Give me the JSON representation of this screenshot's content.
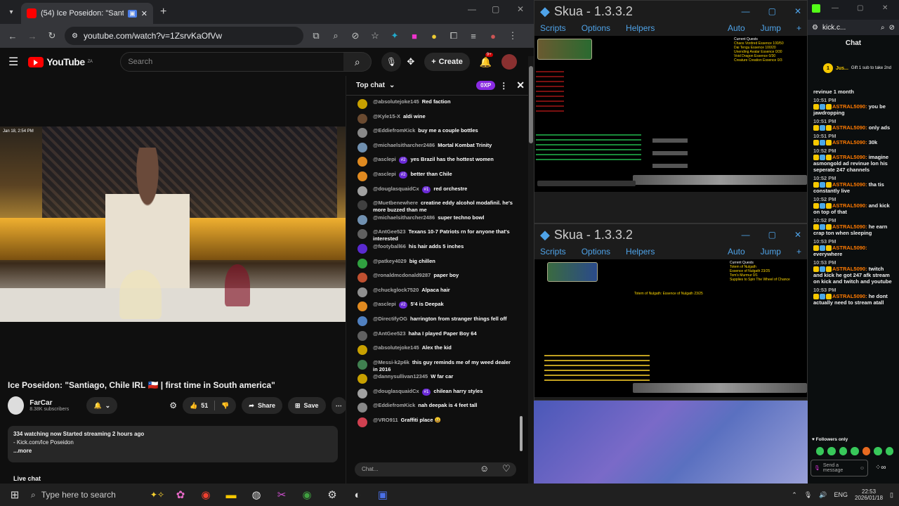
{
  "browser": {
    "tab_title": "(54) Ice Poseidon: \"Santiago, C",
    "url": "youtube.com/watch?v=1ZsrvKaOfVw"
  },
  "youtube": {
    "region": "ZA",
    "search_placeholder": "Search",
    "create_label": "Create",
    "notif_count": "9+",
    "video_overlay_time": "Jan 18, 2:54 PM",
    "title": "Ice Poseidon: \"Santiago, Chile IRL 🇨🇱 | first time in South america\"",
    "channel_name": "FarCar",
    "subscribers": "8.38K subscribers",
    "likes": "51",
    "share_label": "Share",
    "save_label": "Save",
    "desc_line1": "334 watching now  Started streaming 2 hours ago",
    "desc_line2": "- Kick.com/Ice Poseidon",
    "desc_more": "...more",
    "live_chat_label": "Live chat"
  },
  "chat": {
    "header": "Top chat",
    "xp_label": "0XP",
    "input_placeholder": "Chat...",
    "messages": [
      {
        "author": "@absolutejoke145",
        "text": "Red faction",
        "color": "#c8a000"
      },
      {
        "author": "@Kyle15-X",
        "text": "aldi wine",
        "color": "#6a4a30"
      },
      {
        "author": "@EddiefromKick",
        "text": "buy me a couple bottles",
        "color": "#888888"
      },
      {
        "author": "@michaelsitharcher2486",
        "text": "Mortal Kombat Trinity",
        "color": "#7090b0"
      },
      {
        "author": "@asclepi",
        "badge": "#2",
        "text": "yes Brazil has the hottest women",
        "color": "#e08a20"
      },
      {
        "author": "@asclepi",
        "badge": "#2",
        "text": "better than Chile",
        "color": "#e08a20"
      },
      {
        "author": "@douglasquaidCx",
        "badge": "#1",
        "text": "red orchestre",
        "color": "#a0a0a0"
      },
      {
        "author": "@Muetbenewhere",
        "text": "creatine eddy alcohol modafinil. he's more buzzed than me",
        "color": "#404040"
      },
      {
        "author": "@michaelsitharcher2486",
        "text": "super techno bowl",
        "color": "#7090b0"
      },
      {
        "author": "@AntGee523",
        "text": "Texans 10-7 Patriots rn for anyone that's interested",
        "color": "#606060"
      },
      {
        "author": "@footyball66",
        "text": "his hair adds 5 inches",
        "color": "#5a2ad0"
      },
      {
        "author": "@patkey4029",
        "text": "big chillen",
        "color": "#30a040"
      },
      {
        "author": "@ronaldmcdonald9287",
        "text": "paper boy",
        "color": "#c05030"
      },
      {
        "author": "@chuckglock7520",
        "text": "Alpaca hair",
        "color": "#909090"
      },
      {
        "author": "@asclepi",
        "badge": "#2",
        "text": "5'4 is Deepak",
        "color": "#e08a20"
      },
      {
        "author": "@DirectifyOG",
        "text": "harrington from stranger things fell off",
        "color": "#5080c0"
      },
      {
        "author": "@AntGee523",
        "text": "haha I played Paper Boy 64",
        "color": "#606060"
      },
      {
        "author": "@absolutejoke145",
        "text": "Alex the kid",
        "color": "#c8a000"
      },
      {
        "author": "@Messi-k2p6k",
        "text": "this guy reminds me of my weed dealer in 2016",
        "color": "#408050"
      },
      {
        "author": "@dannysullivan12345",
        "text": "W far car",
        "color": "#c8a000"
      },
      {
        "author": "@douglasquaidCx",
        "badge": "#1",
        "text": "chilean harry styles",
        "color": "#a0a0a0"
      },
      {
        "author": "@EddiefromKick",
        "text": "nah deepak is 4 feet tall",
        "color": "#888888"
      },
      {
        "author": "@VRO911",
        "text": "Graffiti place 😀",
        "color": "#d04050"
      }
    ]
  },
  "skua1": {
    "title": "Skua - 1.3.3.2",
    "menu": [
      "Scripts",
      "Options",
      "Helpers"
    ],
    "auto": "Auto",
    "jump": "Jump",
    "quest_lines": [
      "Current Quests",
      "Chaos Vordred Essence 100/50",
      "Dai Tengu Essence 100/20",
      "Unending Avatar Essence 0/30",
      "Void Dragon Essence 0/30",
      "Creature Creation Essence 0/3"
    ]
  },
  "skua2": {
    "title": "Skua - 1.3.3.2",
    "menu": [
      "Scripts",
      "Options",
      "Helpers"
    ],
    "auto": "Auto",
    "jump": "Jump",
    "quest_lines": [
      "Current Quests",
      "Totem of Nulgath",
      "Essence of Nulgath 23/25",
      "Tom's Murmur 0/1",
      "Supplies to Spin The Wheel of Chance"
    ],
    "center_text": "Totem of Nulgath: Essence of Nulgath 23/25"
  },
  "kick": {
    "url": "kick.c...",
    "chat_title": "Chat",
    "pinned_name": "Jus...",
    "pinned_text": "Gift 1 sub to take 2nd",
    "followers_only": "Followers only",
    "input_placeholder": "Send a message",
    "messages": [
      {
        "time": "",
        "name": "",
        "text": "revinue 1 month"
      },
      {
        "time": "10:51 PM",
        "name": "ASTRAL5090:",
        "text": "you be jawdropping"
      },
      {
        "time": "10:51 PM",
        "name": "ASTRAL5090:",
        "text": "only ads"
      },
      {
        "time": "10:51 PM",
        "name": "ASTRAL5090:",
        "text": "30k"
      },
      {
        "time": "10:52 PM",
        "name": "ASTRAL5090:",
        "text": "imagine asmongold ad revinue lon his seperate 247 channels"
      },
      {
        "time": "10:52 PM",
        "name": "ASTRAL5090:",
        "text": "tha tis constantly live"
      },
      {
        "time": "10:52 PM",
        "name": "ASTRAL5090:",
        "text": "and kick on top of that"
      },
      {
        "time": "10:52 PM",
        "name": "ASTRAL5090:",
        "text": "he earn crap ton when sleeping"
      },
      {
        "time": "10:53 PM",
        "name": "ASTRAL5090:",
        "text": "everywhere"
      },
      {
        "time": "10:53 PM",
        "name": "ASTRAL5090:",
        "text": "twitch and kick he got 247 afk stream on kick and twitch and youtube"
      },
      {
        "time": "10:53 PM",
        "name": "ASTRAL5090:",
        "text": "he dont actually need to stream atall"
      }
    ]
  },
  "taskbar": {
    "search_placeholder": "Type here to search",
    "lang": "ENG",
    "time": "22:53",
    "date": "2026/01/18"
  }
}
